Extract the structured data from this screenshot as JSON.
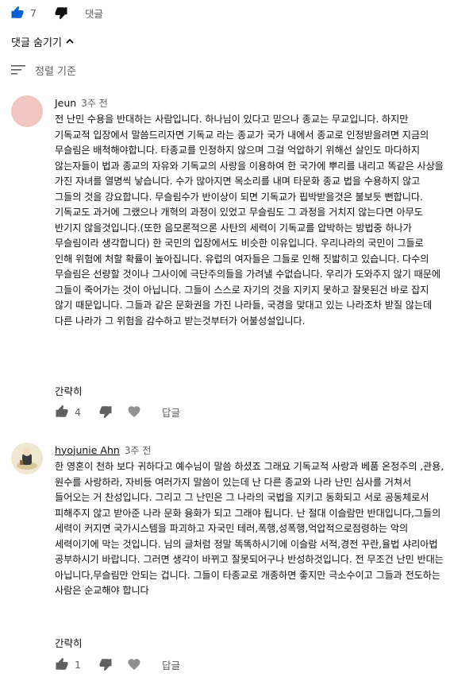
{
  "top_actions": {
    "like_count": "7",
    "reply_label": "댓글"
  },
  "hide_replies_label": "댓글 숨기기",
  "sort_label": "정렬 기준",
  "comments": [
    {
      "author": "Jeun",
      "time": "3주 전",
      "body": "전 난민 수용을 반대하는 사람입니다. 하나님이 있다고 믿으나 종교는 무교입니다. 하지만 기독교적 입장에서 말씀드리자면 기독교 라는 종교가 국가 내에서 종교로 인정받을려면 지금의 무슬림은 배척해야합니다. 타종교를 인정하지 않으며 그걸 억압하기 위해선 살인도 마다하지 않는자들이 법과 종교의 자유와 기독교의 사랑을 이용하여 한 국가에 뿌리를 내리고 똑같은 사상을 가진 자녀를 열명씩 낳습니다. 수가 많아지면 목소리를 내며 타문화 종교 법을 수용하지 않고 그들의 것을 강요합니다. 무슬림수가 반이상이 되면 기독교가 핍박받을것은 불보듯 뻔합니다. 기독교도 과거에 그랬으나 개혁의 과정이 있었고 무슬림도 그 과정을 거치지 않는다면 아무도 반기지 않을것입니다.(또한 음모론적으론 사탄의 세력이 기독교를 압박하는 방법중 하나가 무슬림이라 생각합니다) 한 국민의 입장에서도 비슷한 이유입니다. 우리나라의 국민이 그들로 인해 위험에 처할 확률이 높아집니다. 유럽의 여자들은 그들로 인해 짓밟히고 있습니다. 다수의 무슬림은 선량할 것이나 그사이에 극단주의들을 가려낼 수없습니다. 우리가 도와주지 않기 때문에 그들이 죽어가는 것이 아닙니다. 그들이 스스로 자기의 것을 지키지 못하고 잘못된건 바로 잡지 않기 때문입니다. 그들과 같은 문화권을 가진 나라들, 국경을 맞대고 있는 나라조차 받질 않는데 다른 나라가 그 위험을 감수하고 받는것부터가 어불성설입니다.",
      "collapse_label": "간략히",
      "like_count": "4",
      "reply_label": "답글"
    },
    {
      "author": "hyojunie Ahn",
      "time": "3주 전",
      "body": "한 영혼이 천하 보다 귀하다고 예수님이 말씀 하셨죠 그래요 기독교적 사랑과 베품 온정주의 ,관용,원수를 사랑하라, 자비등 여러가지 말씀이 있는데 난 다른 종교와 나라 난민 심사를 거쳐서 들어오는 거 찬성입니다. 그리고 그 난민은 그 나라의 국법을 지키고 동화되고 서로 공동체로서 피해주지 않고 받아준 나라 문화 융화가 되고 그래야 됩니다. 난 절대 이슬람만 반대입니다,그들의 세력이 커지면 국가시스템을 파괴하고 자국민 테러,폭행,성폭행,억압적으로점령하는 악의 세력이기에 막는 것입니다. 님의 글처럼 정말 똑똑하시기에 이슬람 서적,경전 꾸란,율법 샤리아법 공부하시기 바랍니다. 그러면 생각이 바뀌고 잘못되어구나 반성하것입니다. 전 무조건 난민 반대는 아닙니다,무슬림만 안되는 겁니다. 그들이 타종교로 개종하면 좋지만 극소수이고 그들과 전도하는 사람은 순교해야 합니다",
      "collapse_label": "간략히",
      "like_count": "1",
      "reply_label": "답글"
    }
  ],
  "colors": {
    "avatar1": "#f1c6c2",
    "avatar2": "#efe7cf",
    "muted": "#606060"
  }
}
